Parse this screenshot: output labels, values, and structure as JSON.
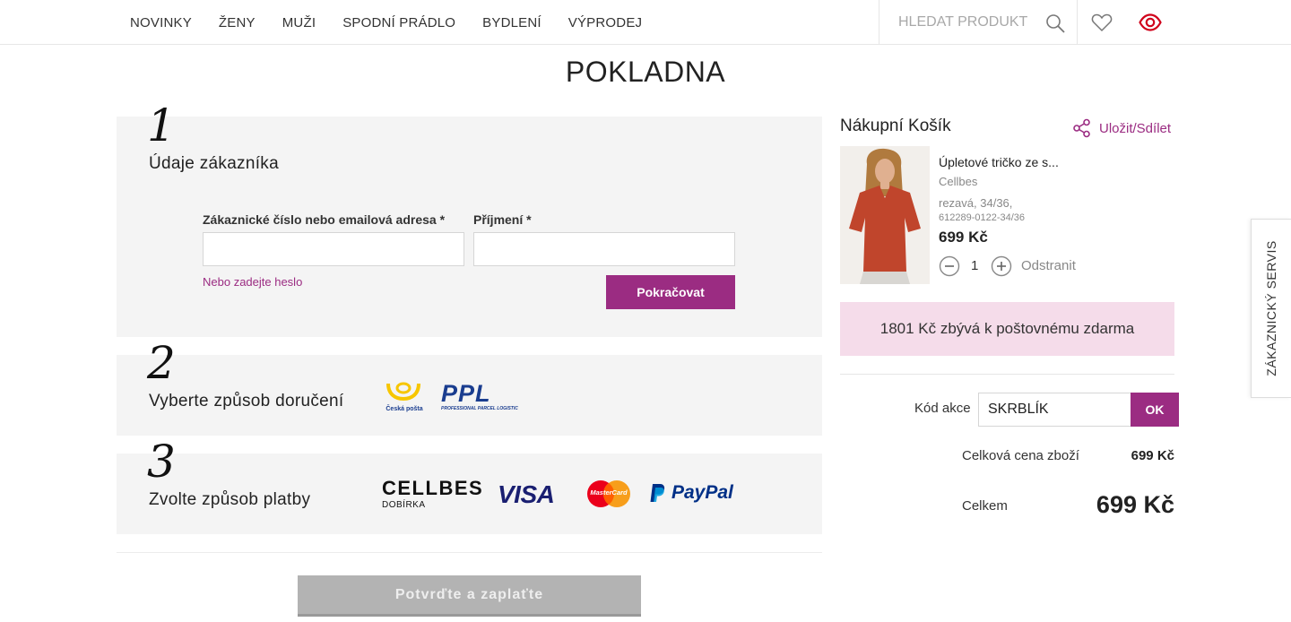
{
  "nav": {
    "items": [
      "NOVINKY",
      "ŽENY",
      "MUŽI",
      "SPODNÍ PRÁDLO",
      "BYDLENÍ",
      "VÝPRODEJ"
    ],
    "search_placeholder": "HLEDAT PRODUKT"
  },
  "page": {
    "title": "POKLADNA"
  },
  "step1": {
    "number": "1",
    "title": "Údaje zákazníka",
    "email_label": "Zákaznické číslo nebo emailová adresa *",
    "email_value": "",
    "lastname_label": "Příjmení *",
    "lastname_value": "",
    "password_link": "Nebo zadejte heslo",
    "continue_button": "Pokračovat"
  },
  "step2": {
    "number": "2",
    "title": "Vyberte způsob doručení",
    "carriers": [
      {
        "name": "Česká pošta",
        "icon": "ceska-posta-logo"
      },
      {
        "name": "PPL",
        "tagline": "PROFESSIONAL PARCEL LOGISTIC",
        "icon": "ppl-logo"
      }
    ]
  },
  "step3": {
    "number": "3",
    "title": "Zvolte způsob platby",
    "methods": [
      {
        "name": "CELLBES",
        "sub": "DOBÍRKA",
        "icon": "cellbes-logo"
      },
      {
        "name": "VISA",
        "icon": "visa-logo"
      },
      {
        "name": "MasterCard",
        "icon": "mastercard-logo"
      },
      {
        "name": "PayPal",
        "icon": "paypal-logo"
      }
    ]
  },
  "confirm_button": "Potvrďte a zaplaťte",
  "cart": {
    "title": "Nákupní Košík",
    "share_label": "Uložit/Sdílet",
    "product": {
      "name": "Úpletové tričko ze s...",
      "brand": "Cellbes",
      "variant": "rezavá, 34/36,",
      "sku": "612289-0122-34/36",
      "price": "699 Kč",
      "quantity": "1",
      "remove_label": "Odstranit"
    },
    "free_shipping": "1801 Kč zbývá k poštovnému zdarma",
    "promo_label": "Kód akce",
    "promo_value": "SKRBLÍK",
    "promo_button": "OK",
    "subtotal_label": "Celková cena zboží",
    "subtotal_value": "699 Kč",
    "total_label": "Celkem",
    "total_value": "699 Kč"
  },
  "side_tab": "ZÁKAZNICKÝ SERVIS",
  "colors": {
    "accent": "#9b2c82",
    "free_ship_bg": "#f5dcea",
    "step_bg": "#f4f4f4",
    "eye_icon": "#d0021b"
  }
}
